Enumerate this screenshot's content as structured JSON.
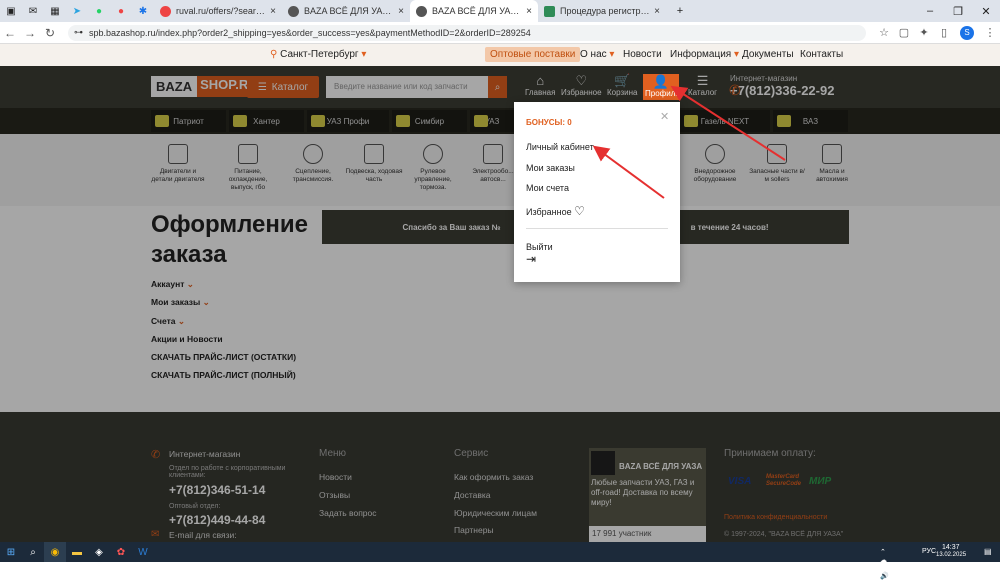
{
  "browser": {
    "tabs": [
      {
        "label": "ruval.ru/offers/?search_search=..."
      },
      {
        "label": "BAZA ВСЁ ДЛЯ УАЗА - Интер..."
      },
      {
        "label": "BAZA ВСЁ ДЛЯ УАЗА - Интер..."
      },
      {
        "label": "Процедура регистрации на са..."
      }
    ],
    "url": "spb.bazashop.ru/index.php?order2_shipping=yes&order_success=yes&paymentMethodID=2&orderID=289254",
    "profile_letter": "S"
  },
  "topnav": {
    "city": "Санкт-Петербург",
    "wholesale": "Оптовые поставки",
    "links": [
      "О нас",
      "Новости",
      "Информация",
      "Документы",
      "Контакты"
    ]
  },
  "header": {
    "logo_a": "BAZA",
    "logo_b": "SHOP.RU",
    "catalog": "Каталог",
    "search_placeholder": "Введите название или код запчасти",
    "icons": [
      "Главная",
      "Избранное",
      "Корзина",
      "Профиль",
      "Каталог"
    ],
    "phone_label": "Интернет-магазин",
    "phone": "+7(812)336-22-92"
  },
  "models": [
    "Патриот",
    "Хантер",
    "УАЗ Профи",
    "Симбир",
    "УАЗ",
    "Газель NEXT",
    "ВАЗ"
  ],
  "categories": [
    "Двигатели и детали двигателя",
    "Питание, охлаждение, выпуск, гбо",
    "Сцепление, трансмиссия.",
    "Подвеска, ходовая часть",
    "Рулевое управление, тормоза.",
    "Электрообо... автосв...",
    "Внедорожное оборудование",
    "Запасные части в/м sollers",
    "Масла и автохимия"
  ],
  "main": {
    "title_1": "Оформление",
    "title_2": "заказа",
    "alert_left": "Спасибо за Ваш заказ №",
    "alert_right": "в течение 24 часов!",
    "side": [
      "Аккаунт",
      "Мои заказы",
      "Счета",
      "Акции и Новости",
      "СКАЧАТЬ ПРАЙС-ЛИСТ (ОСТАТКИ)",
      "СКАЧАТЬ ПРАЙС-ЛИСТ (ПОЛНЫЙ)"
    ]
  },
  "footer": {
    "shop": "Интернет-магазин",
    "corp": "Отдел по работе с корпоративными клиентами:",
    "phone1": "+7(812)346-51-14",
    "wholesale": "Оптовый отдел:",
    "phone2": "+7(812)449-44-84",
    "email": "E-mail для связи:",
    "menu_title": "Меню",
    "menu": [
      "Новости",
      "Отзывы",
      "Задать вопрос"
    ],
    "service_title": "Сервис",
    "service": [
      "Как оформить заказ",
      "Доставка",
      "Юридическим лицам",
      "Партнеры"
    ],
    "promo_title": "BAZA ВСЁ ДЛЯ УАЗА",
    "promo_text": "Любые запчасти УАЗ, ГАЗ и off-road! Доставка по всему миру!",
    "members": "17 991 участник",
    "pay_title": "Принимаем оплату:",
    "pay": [
      "VISA",
      "MasterCard SecureCode",
      "МИР"
    ],
    "privacy": "Политика конфиденциальности",
    "copyright": "© 1997-2024, \"BAZA ВСЁ ДЛЯ УАЗА\""
  },
  "dropdown": {
    "bonus": "БОНУСЫ: 0",
    "items": [
      "Личный кабинет",
      "Мои заказы",
      "Мои счета",
      "Избранное"
    ],
    "logout": "Выйти"
  },
  "taskbar": {
    "lang": "РУС",
    "time": "14:37",
    "date": "13.02.2025"
  },
  "colors": {
    "accent": "#e06020",
    "header": "#3c3e35",
    "footer": "#3a3b33"
  }
}
